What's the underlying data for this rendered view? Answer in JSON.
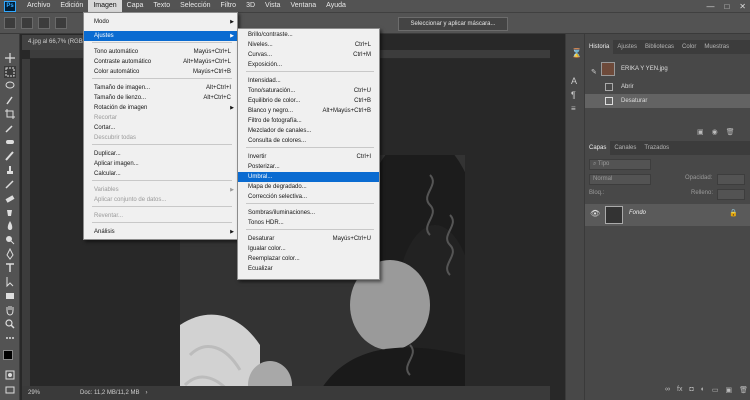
{
  "menubar": {
    "logo": "Ps",
    "items": [
      "Archivo",
      "Edición",
      "Imagen",
      "Capa",
      "Texto",
      "Selección",
      "Filtro",
      "3D",
      "Vista",
      "Ventana",
      "Ayuda"
    ],
    "active_item": "Imagen"
  },
  "window_controls": {
    "minimize": "—",
    "maximize": "□",
    "close": "✕"
  },
  "options_bar": {
    "select_mask_button": "Seleccionar y aplicar máscara..."
  },
  "document": {
    "tab_title": "4.jpg al 66,7% (RGB/8#)",
    "status_zoom": "29%",
    "status_doc": "Doc: 11,2 MB/11,2 MB"
  },
  "image_menu": {
    "items": [
      {
        "label": "Modo",
        "shortcut": "",
        "submenu": true,
        "disabled": false
      },
      {
        "label": "Ajustes",
        "shortcut": "",
        "submenu": true,
        "disabled": false,
        "highlighted": true
      },
      {
        "label": "Tono automático",
        "shortcut": "Mayús+Ctrl+L",
        "disabled": false
      },
      {
        "label": "Contraste automático",
        "shortcut": "Alt+Mayús+Ctrl+L",
        "disabled": false
      },
      {
        "label": "Color automático",
        "shortcut": "Mayús+Ctrl+B",
        "disabled": false
      },
      {
        "label": "Tamaño de imagen...",
        "shortcut": "Alt+Ctrl+I",
        "disabled": false
      },
      {
        "label": "Tamaño de lienzo...",
        "shortcut": "Alt+Ctrl+C",
        "disabled": false
      },
      {
        "label": "Rotación de imagen",
        "shortcut": "",
        "submenu": true,
        "disabled": false
      },
      {
        "label": "Recortar",
        "shortcut": "",
        "disabled": true
      },
      {
        "label": "Cortar...",
        "shortcut": "",
        "disabled": false
      },
      {
        "label": "Descubrir todas",
        "shortcut": "",
        "disabled": true
      },
      {
        "label": "Duplicar...",
        "shortcut": "",
        "disabled": false
      },
      {
        "label": "Aplicar imagen...",
        "shortcut": "",
        "disabled": false
      },
      {
        "label": "Calcular...",
        "shortcut": "",
        "disabled": false
      },
      {
        "label": "Variables",
        "shortcut": "",
        "submenu": true,
        "disabled": true
      },
      {
        "label": "Aplicar conjunto de datos...",
        "shortcut": "",
        "disabled": true
      },
      {
        "label": "Reventar...",
        "shortcut": "",
        "disabled": true
      },
      {
        "label": "Análisis",
        "shortcut": "",
        "submenu": true,
        "disabled": false
      }
    ]
  },
  "adjustments_menu": {
    "items": [
      {
        "label": "Brillo/contraste...",
        "shortcut": ""
      },
      {
        "label": "Niveles...",
        "shortcut": "Ctrl+L"
      },
      {
        "label": "Curvas...",
        "shortcut": "Ctrl+M"
      },
      {
        "label": "Exposición...",
        "shortcut": ""
      },
      {
        "label": "Intensidad...",
        "shortcut": ""
      },
      {
        "label": "Tono/saturación...",
        "shortcut": "Ctrl+U"
      },
      {
        "label": "Equilibrio de color...",
        "shortcut": "Ctrl+B"
      },
      {
        "label": "Blanco y negro...",
        "shortcut": "Alt+Mayús+Ctrl+B"
      },
      {
        "label": "Filtro de fotografía...",
        "shortcut": ""
      },
      {
        "label": "Mezclador de canales...",
        "shortcut": ""
      },
      {
        "label": "Consulta de colores...",
        "shortcut": ""
      },
      {
        "label": "Invertir",
        "shortcut": "Ctrl+I"
      },
      {
        "label": "Posterizar...",
        "shortcut": ""
      },
      {
        "label": "Umbral...",
        "shortcut": "",
        "highlighted": true
      },
      {
        "label": "Mapa de degradado...",
        "shortcut": ""
      },
      {
        "label": "Corrección selectiva...",
        "shortcut": ""
      },
      {
        "label": "Sombras/iluminaciones...",
        "shortcut": ""
      },
      {
        "label": "Tonos HDR...",
        "shortcut": ""
      },
      {
        "label": "Desaturar",
        "shortcut": "Mayús+Ctrl+U"
      },
      {
        "label": "Igualar color...",
        "shortcut": ""
      },
      {
        "label": "Reemplazar color...",
        "shortcut": ""
      },
      {
        "label": "Ecualizar",
        "shortcut": ""
      }
    ]
  },
  "history_panel": {
    "tabs": [
      "Historia",
      "Ajustes",
      "Bibliotecas",
      "Color",
      "Muestras"
    ],
    "active_tab": "Historia",
    "snapshot": "ERIKA Y YEN.jpg",
    "steps": [
      "Abrir",
      "Desaturar"
    ],
    "selected_step": "Desaturar"
  },
  "layers_panel": {
    "tabs": [
      "Capas",
      "Canales",
      "Trazados"
    ],
    "active_tab": "Capas",
    "search_placeholder": "Tipo",
    "blend_mode": "Normal",
    "opacity_label": "Opacidad:",
    "fill_label": "Relleno:",
    "lock_label": "Bloq.:",
    "layer_name": "Fondo"
  }
}
